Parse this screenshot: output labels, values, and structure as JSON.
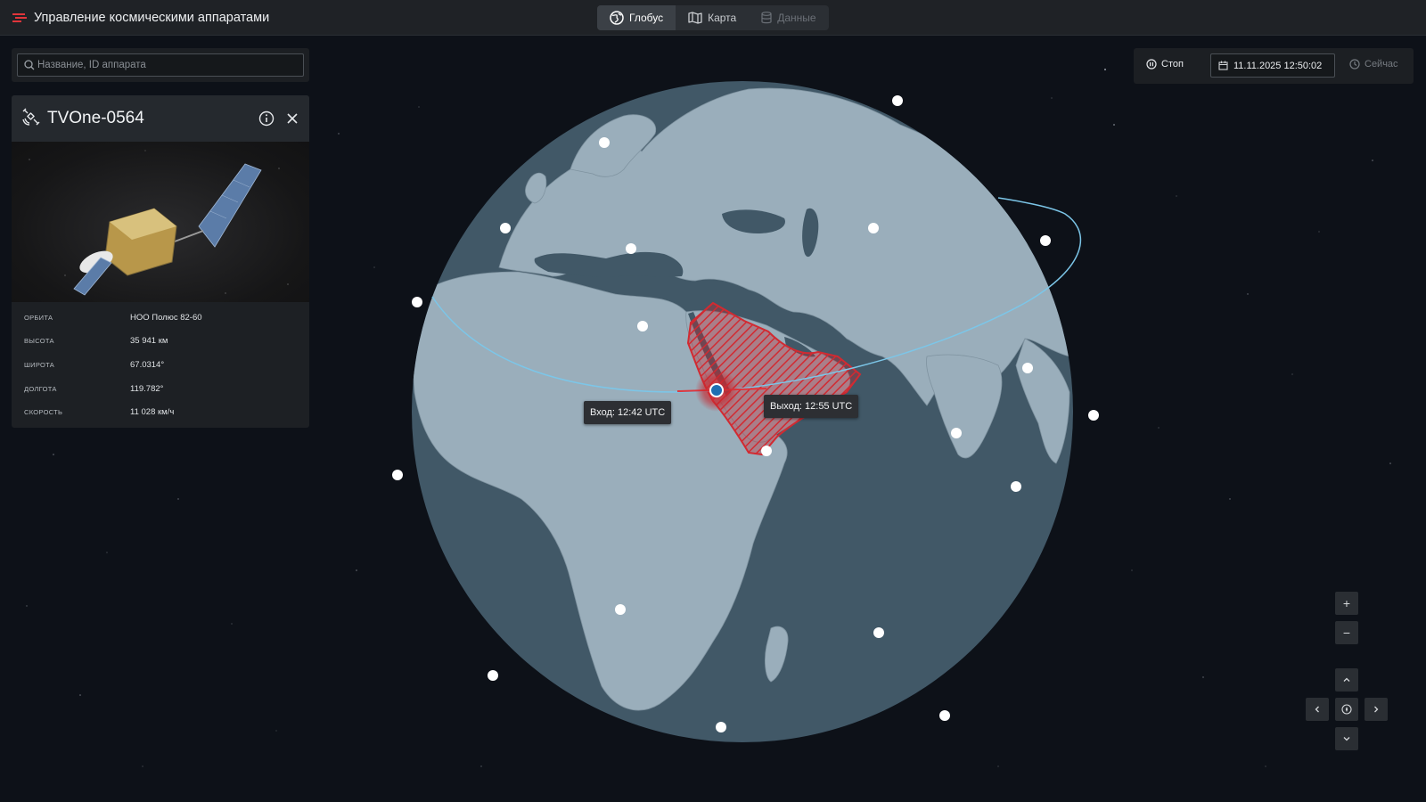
{
  "app": {
    "title": "Управление космическими аппаратами"
  },
  "view_switch": {
    "tabs": [
      {
        "label": "Глобус",
        "icon": "globe-icon",
        "state": "active"
      },
      {
        "label": "Карта",
        "icon": "map-icon",
        "state": "normal"
      },
      {
        "label": "Данные",
        "icon": "database-icon",
        "state": "disabled"
      }
    ]
  },
  "search": {
    "placeholder": "Название, ID аппарата",
    "value": ""
  },
  "satellite": {
    "name": "TVOne-0564",
    "params": [
      {
        "key": "ОРБИТА",
        "value": "НОО Полюс 82-60"
      },
      {
        "key": "ВЫСОТА",
        "value": "35 941 км"
      },
      {
        "key": "ШИРОТА",
        "value": "67.0314°"
      },
      {
        "key": "ДОЛГОТА",
        "value": "119.782°"
      },
      {
        "key": "СКОРОСТЬ",
        "value": "11 028 км/ч"
      }
    ]
  },
  "time": {
    "stop_label": "Стоп",
    "datetime": "11.11.2025 12:50:02",
    "now_label": "Сейчас"
  },
  "globe": {
    "entry_label": "Вход: 12:42 UTC",
    "exit_label": "Выход: 12:55 UTC"
  },
  "map_controls": {
    "zoom_in": "+",
    "zoom_out": "−"
  },
  "colors": {
    "ocean": "#415867",
    "land": "#9aaebb",
    "orbit": "#7cc6e8",
    "zone": "#c8252c",
    "selected_sat": "#1f6fb2",
    "logo": "#e0353b"
  }
}
